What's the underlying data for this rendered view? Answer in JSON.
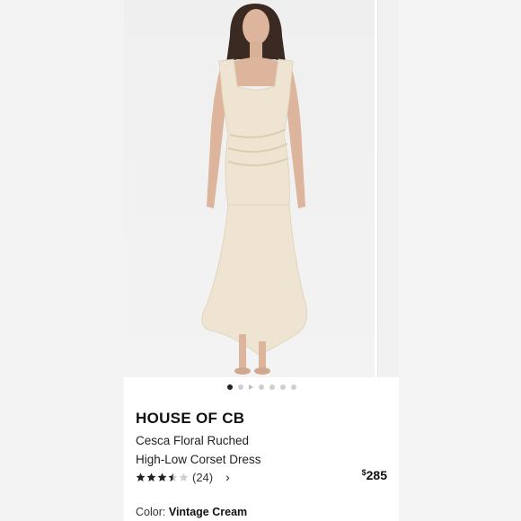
{
  "product": {
    "brand": "HOUSE OF CB",
    "name_line1": "Cesca Floral Ruched",
    "name_line2": "High-Low Corset Dress",
    "rating": 3.5,
    "rating_max": 5,
    "review_count": "(24)",
    "price_symbol": "$",
    "price_amount": "285",
    "color_label": "Color: ",
    "color_value": "Vintage Cream"
  },
  "carousel": {
    "total_dots": 7,
    "active_index": 0,
    "video_index": 2
  },
  "colors": {
    "dress": "#efe4d1",
    "star": "#222222"
  },
  "icons": {
    "review_chevron": "chevron-right-icon"
  }
}
